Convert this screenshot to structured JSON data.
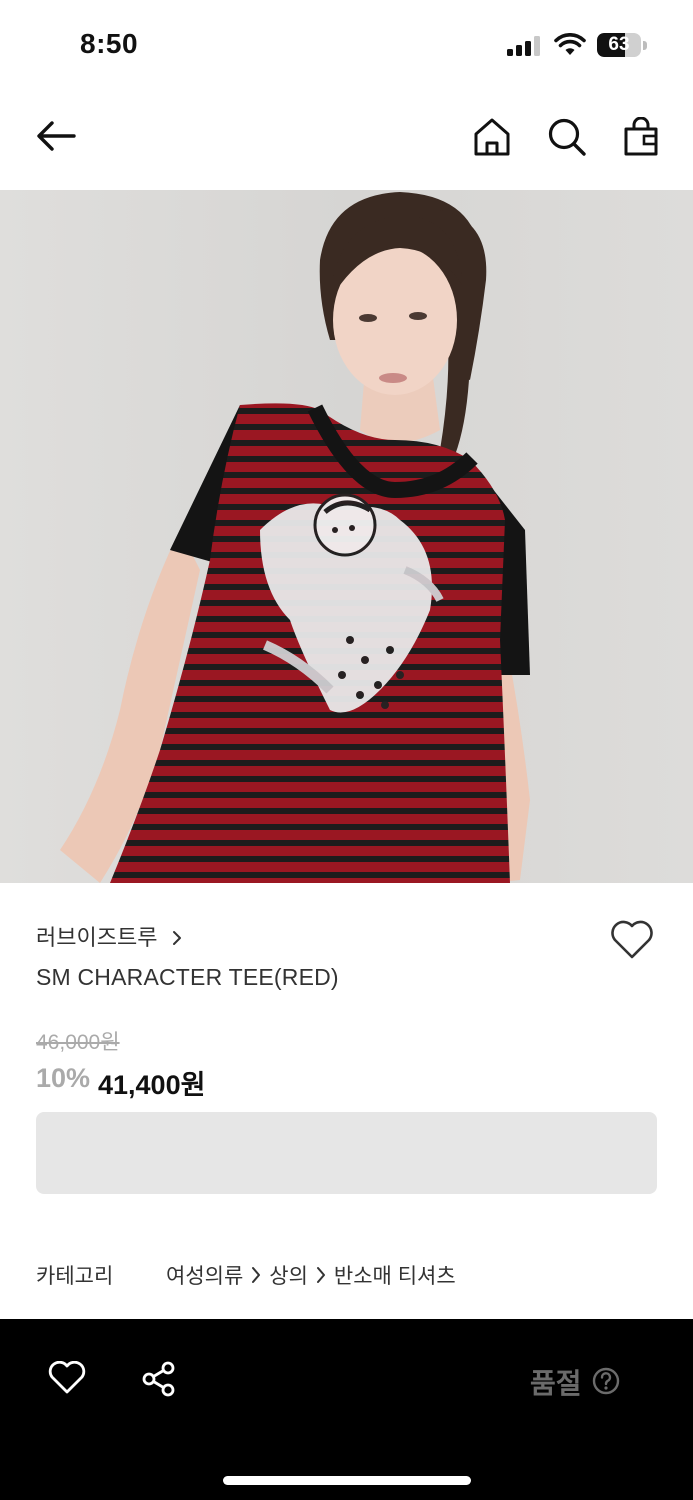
{
  "status_bar": {
    "time": "8:50",
    "battery": "63",
    "battery_level": 0.63
  },
  "nav": {
    "back_icon": "arrow-left-icon",
    "home_icon": "home-icon",
    "search_icon": "search-icon",
    "bag_icon": "shopping-bag-icon"
  },
  "product": {
    "brand": "러브이즈트루",
    "name": "SM CHARACTER TEE(RED)",
    "original_price": "46,000원",
    "discount": "10%",
    "sale_price": "41,400원",
    "wishlist_icon": "heart-icon",
    "colors": {
      "stripe_red": "#9a1722",
      "stripe_dark": "#1c1c1c",
      "background": "#dcdbd9"
    }
  },
  "category": {
    "label": "카테고리",
    "path": [
      "여성의류",
      "상의",
      "반소매 티셔츠"
    ]
  },
  "bottom_bar": {
    "like_icon": "heart-outline-icon",
    "share_icon": "share-icon",
    "status_label": "품절",
    "help_icon": "question-circle-icon"
  }
}
